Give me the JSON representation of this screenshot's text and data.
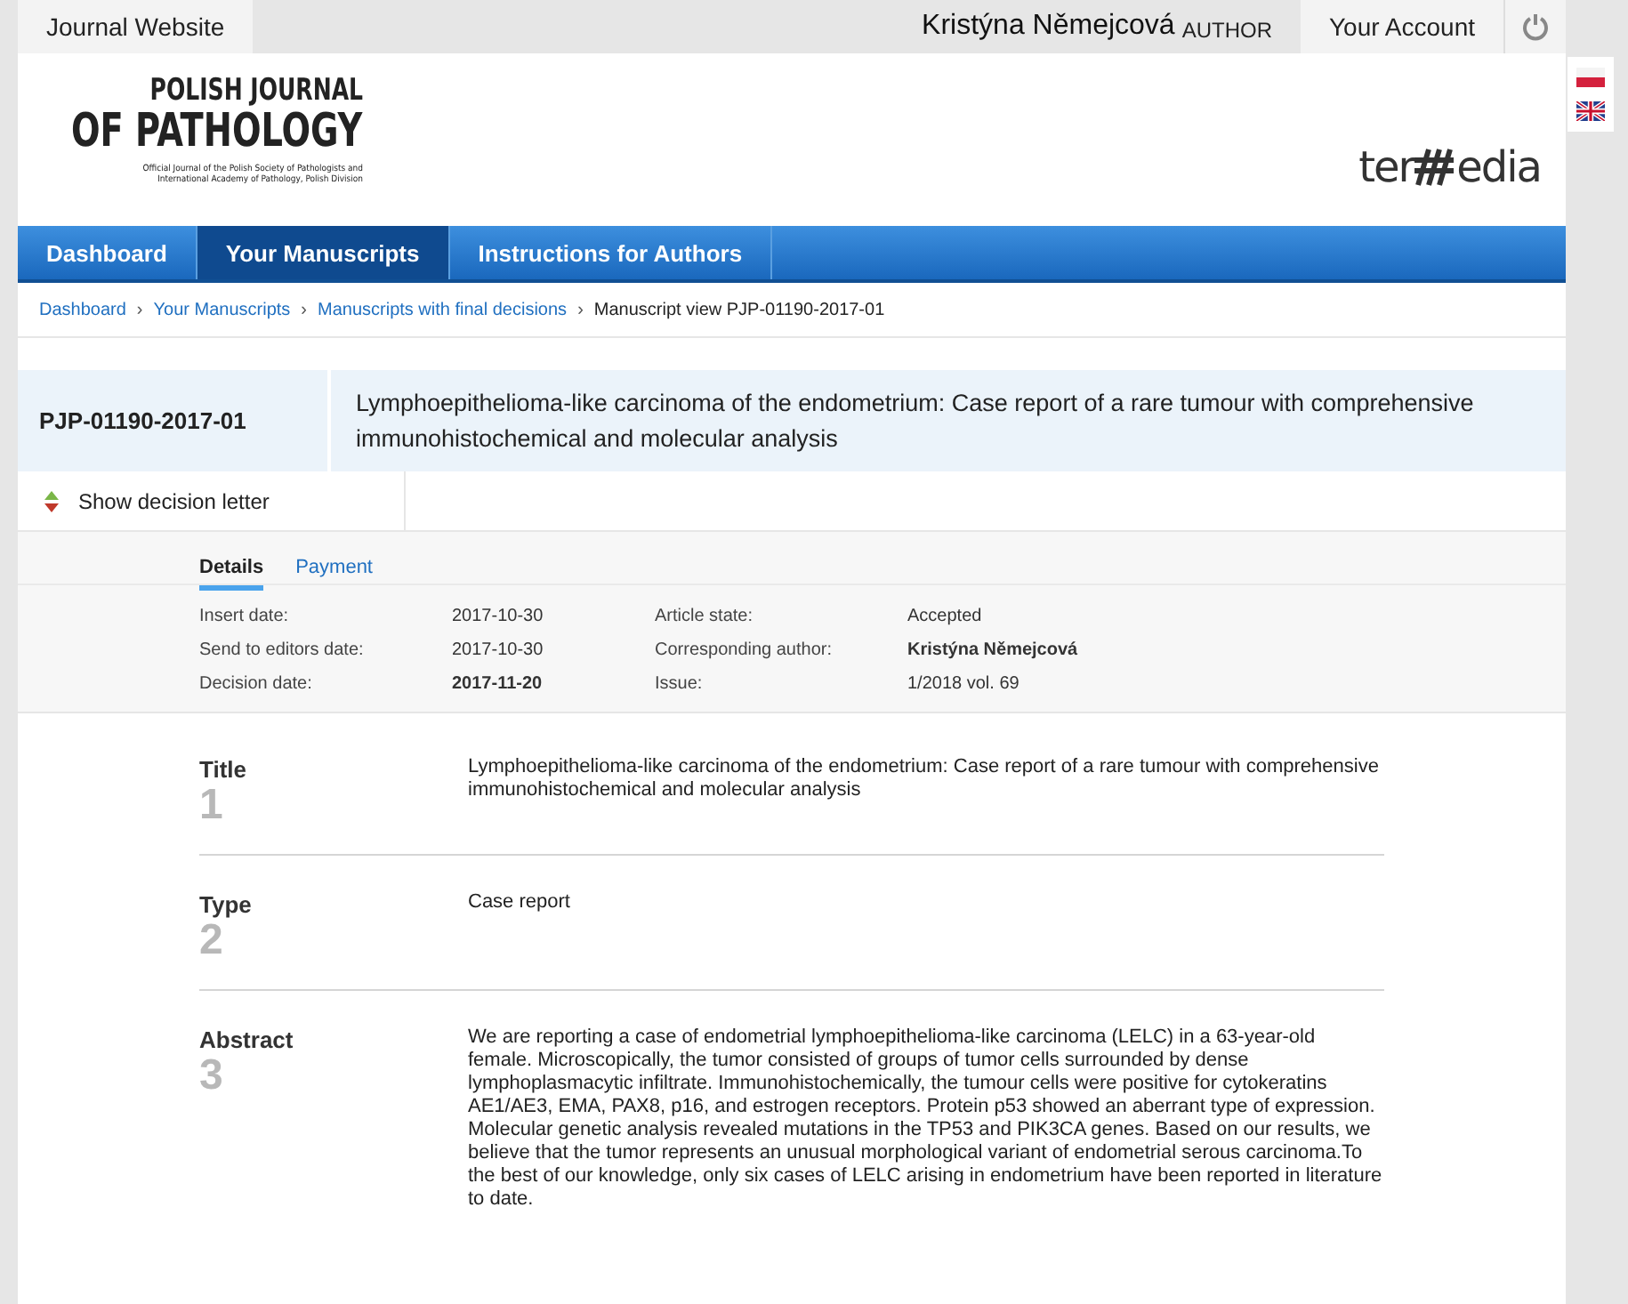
{
  "top_bar": {
    "site_link": "Journal Website",
    "user_name": "Kristýna Němejcová",
    "user_role": "AUTHOR",
    "account_link": "Your Account"
  },
  "header": {
    "logo_line1": "POLISH JOURNAL",
    "logo_line2": "OF PATHOLOGY",
    "logo_subtitle": "Official Journal of the Polish Society of Pathologists and International Academy of Pathology, Polish Division",
    "publisher_left": "ter",
    "publisher_right": "edia"
  },
  "languages": [
    {
      "kind": "pl"
    },
    {
      "kind": "en"
    }
  ],
  "nav": [
    {
      "label": "Dashboard",
      "selected": false
    },
    {
      "label": "Your Manuscripts",
      "selected": true
    },
    {
      "label": "Instructions for Authors",
      "selected": false
    }
  ],
  "breadcrumb": [
    {
      "label": "Dashboard",
      "link": true
    },
    {
      "separator": "›",
      "label": "Your Manuscripts",
      "link": true
    },
    {
      "separator": "›",
      "label": "Manuscripts with final decisions",
      "link": true
    },
    {
      "separator": "›",
      "label": "Manuscript view PJP-01190-2017-01",
      "link": false
    }
  ],
  "manuscript": {
    "id": "PJP-01190-2017-01",
    "title": "Lymphoepithelioma-like carcinoma of the endometrium: Case report of a rare tumour with comprehensive immunohistochemical and molecular analysis"
  },
  "decision_toggle": "Show decision letter",
  "tabs": [
    {
      "label": "Details",
      "selected": true
    },
    {
      "label": "Payment",
      "selected": false
    }
  ],
  "details": [
    [
      {
        "label": "Insert date:",
        "value": "2017-10-30",
        "bold": false
      },
      {
        "label": "Send to editors date:",
        "value": "2017-10-30",
        "bold": false
      },
      {
        "label": "Decision date:",
        "value": "2017-11-20",
        "bold": true
      }
    ],
    [
      {
        "label": "Article state:",
        "value": "Accepted",
        "bold": false
      },
      {
        "label": "Corresponding author:",
        "value": "Kristýna Němejcová",
        "bold": true
      },
      {
        "label": "Issue:",
        "value": "1/2018 vol. 69",
        "bold": false
      }
    ]
  ],
  "sections": [
    {
      "label": "Title",
      "number": "1",
      "text": "Lymphoepithelioma-like carcinoma of the endometrium: Case report of a rare tumour with comprehensive immunohistochemical and molecular analysis"
    },
    {
      "label": "Type",
      "number": "2",
      "text": "Case report"
    },
    {
      "label": "Abstract",
      "number": "3",
      "text": "We are reporting a case of endometrial lymphoepithelioma-like carcinoma (LELC) in a 63-year-old female. Microscopically, the tumor consisted of groups of tumor cells surrounded by dense lymphoplasmacytic infiltrate. Immunohistochemically, the tumour cells were positive for cytokeratins AE1/AE3, EMA, PAX8, p16, and estrogen receptors. Protein p53 showed an aberrant type of expression. Molecular genetic analysis revealed mutations in the TP53 and PIK3CA genes. Based on our results, we believe that the tumor represents an unusual morphological variant of endometrial serous carcinoma.To the best of our knowledge, only six cases of LELC arising in endometrium have been reported in literature to date."
    }
  ]
}
